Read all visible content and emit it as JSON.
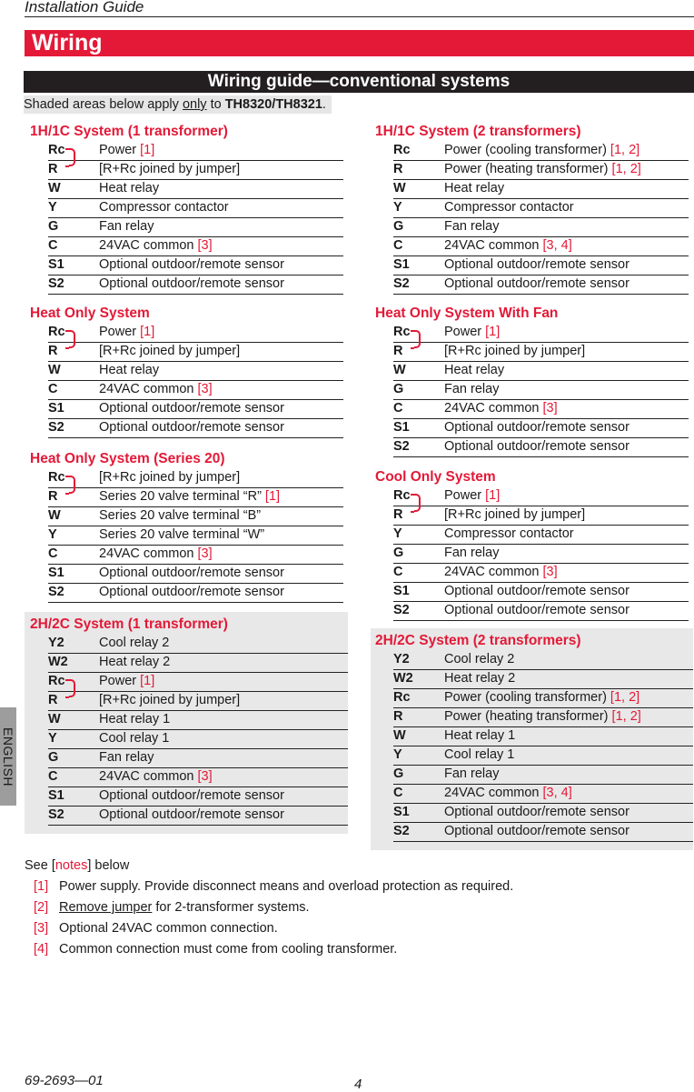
{
  "running_head": "Installation Guide",
  "section_title": "Wiring",
  "subsection_title": "Wiring guide—conventional systems",
  "shade_note": {
    "prefix": "Shaded areas below apply ",
    "emphasis": "only",
    "middle": " to ",
    "models": "TH8320/TH8321",
    "suffix": "."
  },
  "colors": {
    "accent": "#e31937",
    "bar_dark": "#231f20",
    "shade": "#e8e8e8",
    "tab": "#9d9d9d"
  },
  "blocks": [
    {
      "title": "1H/1C System (1 transformer)",
      "shaded": false,
      "jumper": true,
      "rows": [
        {
          "term": "Rc",
          "desc": "Power ",
          "ref": "[1]"
        },
        {
          "term": "R",
          "desc": "[R+Rc joined by jumper]",
          "ref": ""
        },
        {
          "term": "W",
          "desc": "Heat relay",
          "ref": ""
        },
        {
          "term": "Y",
          "desc": "Compressor contactor",
          "ref": ""
        },
        {
          "term": "G",
          "desc": "Fan relay",
          "ref": ""
        },
        {
          "term": "C",
          "desc": "24VAC common ",
          "ref": "[3]"
        },
        {
          "term": "S1",
          "desc": "Optional outdoor/remote sensor",
          "ref": ""
        },
        {
          "term": "S2",
          "desc": "Optional outdoor/remote sensor",
          "ref": ""
        }
      ]
    },
    {
      "title": "1H/1C System (2 transformers)",
      "shaded": false,
      "jumper": false,
      "rows": [
        {
          "term": "Rc",
          "desc": "Power (cooling transformer) ",
          "ref": "[1, 2]"
        },
        {
          "term": "R",
          "desc": "Power (heating transformer) ",
          "ref": "[1, 2]"
        },
        {
          "term": "W",
          "desc": "Heat relay",
          "ref": ""
        },
        {
          "term": "Y",
          "desc": "Compressor contactor",
          "ref": ""
        },
        {
          "term": "G",
          "desc": "Fan relay",
          "ref": ""
        },
        {
          "term": "C",
          "desc": "24VAC common ",
          "ref": "[3, 4]"
        },
        {
          "term": "S1",
          "desc": "Optional outdoor/remote sensor",
          "ref": ""
        },
        {
          "term": "S2",
          "desc": "Optional outdoor/remote sensor",
          "ref": ""
        }
      ]
    },
    {
      "title": "Heat Only System",
      "shaded": false,
      "jumper": true,
      "rows": [
        {
          "term": "Rc",
          "desc": "Power ",
          "ref": "[1]"
        },
        {
          "term": "R",
          "desc": "[R+Rc joined by jumper]",
          "ref": ""
        },
        {
          "term": "W",
          "desc": "Heat relay",
          "ref": ""
        },
        {
          "term": "C",
          "desc": "24VAC common ",
          "ref": "[3]"
        },
        {
          "term": "S1",
          "desc": "Optional outdoor/remote sensor",
          "ref": ""
        },
        {
          "term": "S2",
          "desc": "Optional outdoor/remote sensor",
          "ref": ""
        }
      ]
    },
    {
      "title": "Heat Only System With Fan",
      "shaded": false,
      "jumper": true,
      "rows": [
        {
          "term": "Rc",
          "desc": "Power ",
          "ref": "[1]"
        },
        {
          "term": "R",
          "desc": "[R+Rc joined by jumper]",
          "ref": ""
        },
        {
          "term": "W",
          "desc": "Heat relay",
          "ref": ""
        },
        {
          "term": "G",
          "desc": "Fan relay",
          "ref": ""
        },
        {
          "term": "C",
          "desc": "24VAC common ",
          "ref": "[3]"
        },
        {
          "term": "S1",
          "desc": "Optional outdoor/remote sensor",
          "ref": ""
        },
        {
          "term": "S2",
          "desc": "Optional outdoor/remote sensor",
          "ref": ""
        }
      ]
    },
    {
      "title": "Heat Only System (Series 20)",
      "shaded": false,
      "jumper": true,
      "rows": [
        {
          "term": "Rc",
          "desc": "[R+Rc joined by jumper]",
          "ref": ""
        },
        {
          "term": "R",
          "desc": "Series 20 valve terminal “R” ",
          "ref": "[1]"
        },
        {
          "term": "W",
          "desc": "Series 20 valve terminal “B”",
          "ref": ""
        },
        {
          "term": "Y",
          "desc": "Series 20 valve terminal “W”",
          "ref": ""
        },
        {
          "term": "C",
          "desc": "24VAC common ",
          "ref": "[3]"
        },
        {
          "term": "S1",
          "desc": "Optional outdoor/remote sensor",
          "ref": ""
        },
        {
          "term": "S2",
          "desc": "Optional outdoor/remote sensor",
          "ref": ""
        }
      ]
    },
    {
      "title": "Cool Only System",
      "shaded": false,
      "jumper": true,
      "rows": [
        {
          "term": "Rc",
          "desc": "Power ",
          "ref": "[1]"
        },
        {
          "term": "R",
          "desc": "[R+Rc joined by jumper]",
          "ref": ""
        },
        {
          "term": "Y",
          "desc": "Compressor contactor",
          "ref": ""
        },
        {
          "term": "G",
          "desc": "Fan relay",
          "ref": ""
        },
        {
          "term": "C",
          "desc": "24VAC common ",
          "ref": "[3]"
        },
        {
          "term": "S1",
          "desc": "Optional outdoor/remote sensor",
          "ref": ""
        },
        {
          "term": "S2",
          "desc": "Optional outdoor/remote sensor",
          "ref": ""
        }
      ]
    },
    {
      "title": "2H/2C System (1 transformer)",
      "shaded": true,
      "jumper": true,
      "jumper_row": 2,
      "rows": [
        {
          "term": "Y2",
          "desc": "Cool relay 2",
          "ref": ""
        },
        {
          "term": "W2",
          "desc": "Heat relay 2",
          "ref": ""
        },
        {
          "term": "Rc",
          "desc": "Power ",
          "ref": "[1]"
        },
        {
          "term": "R",
          "desc": "[R+Rc joined by jumper]",
          "ref": ""
        },
        {
          "term": "W",
          "desc": "Heat relay 1",
          "ref": ""
        },
        {
          "term": "Y",
          "desc": "Cool relay 1",
          "ref": ""
        },
        {
          "term": "G",
          "desc": "Fan relay",
          "ref": ""
        },
        {
          "term": "C",
          "desc": "24VAC common ",
          "ref": "[3]"
        },
        {
          "term": "S1",
          "desc": "Optional outdoor/remote sensor",
          "ref": ""
        },
        {
          "term": "S2",
          "desc": "Optional outdoor/remote sensor",
          "ref": ""
        }
      ]
    },
    {
      "title": "2H/2C System (2 transformers)",
      "shaded": true,
      "jumper": false,
      "rows": [
        {
          "term": "Y2",
          "desc": "Cool relay 2",
          "ref": ""
        },
        {
          "term": "W2",
          "desc": "Heat relay 2",
          "ref": ""
        },
        {
          "term": "Rc",
          "desc": "Power (cooling transformer) ",
          "ref": "[1, 2]"
        },
        {
          "term": "R",
          "desc": "Power (heating transformer) ",
          "ref": "[1, 2]"
        },
        {
          "term": "W",
          "desc": "Heat relay 1",
          "ref": ""
        },
        {
          "term": "Y",
          "desc": "Cool relay 1",
          "ref": ""
        },
        {
          "term": "G",
          "desc": "Fan relay",
          "ref": ""
        },
        {
          "term": "C",
          "desc": "24VAC common ",
          "ref": "[3, 4]"
        },
        {
          "term": "S1",
          "desc": "Optional outdoor/remote sensor",
          "ref": ""
        },
        {
          "term": "S2",
          "desc": "Optional outdoor/remote sensor",
          "ref": ""
        }
      ]
    }
  ],
  "notes": {
    "intro_prefix": "See [",
    "intro_link": "notes",
    "intro_suffix": "] below",
    "items": [
      {
        "num": "[1]",
        "underlined": "",
        "text": "Power supply. Provide disconnect means and overload protection as required."
      },
      {
        "num": "[2]",
        "underlined": "Remove jumper",
        "text": " for 2-transformer systems."
      },
      {
        "num": "[3]",
        "underlined": "",
        "text": "Optional 24VAC common connection."
      },
      {
        "num": "[4]",
        "underlined": "",
        "text": "Common connection must come from cooling transformer."
      }
    ]
  },
  "language_tab": "ENGLISH",
  "footer": {
    "doc_number": "69-2693—01",
    "page_number": "4"
  }
}
